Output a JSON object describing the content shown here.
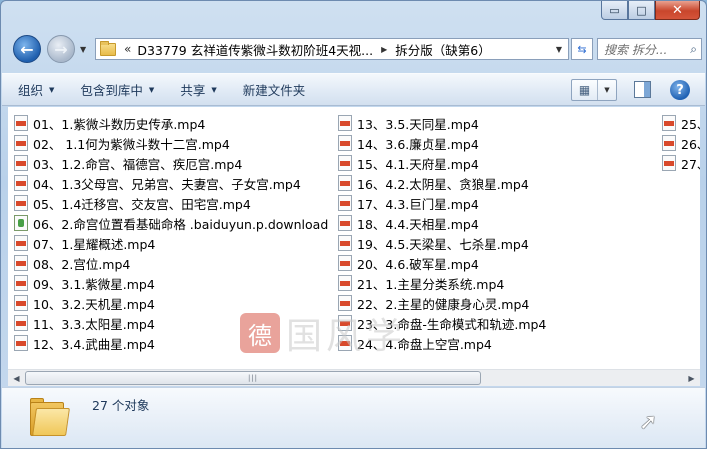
{
  "window": {
    "caption_buttons": {
      "minimize": "▭",
      "maximize": "□",
      "close": "✕"
    }
  },
  "nav": {
    "back_glyph": "←",
    "forward_glyph": "→",
    "dropdown_glyph": "▼",
    "address": {
      "chevrons": "«",
      "segments": [
        "D33779 玄祥道传紫微斗数初阶班4天视...",
        "拆分版（缺第6）"
      ],
      "separator": "▶",
      "dropdown_glyph": "▼"
    },
    "refresh_glyph": "⇆",
    "search": {
      "placeholder": "搜索 拆分...",
      "icon": "search-icon",
      "glyph": "⌕"
    }
  },
  "toolbar": {
    "organize": "组织",
    "include_in_library": "包含到库中",
    "share": "共享",
    "new_folder": "新建文件夹",
    "arrow": "▼",
    "view_icon_glyph": "▦",
    "help_glyph": "?"
  },
  "files": {
    "column1": [
      "01、1.紫微斗数历史传承.mp4",
      "02、 1.1何为紫微斗数十二宫.mp4",
      "03、1.2.命宫、福德宫、疾厄宫.mp4",
      "04、1.3父母宫、兄弟宫、夫妻宫、子女宫.mp4",
      "05、1.4迁移宫、交友宫、田宅宫.mp4",
      "06、2.命宫位置看基础命格 .baiduyun.p.download",
      "07、1.星耀概述.mp4",
      "08、2.宫位.mp4",
      "09、3.1.紫微星.mp4",
      "10、3.2.天机星.mp4",
      "11、3.3.太阳星.mp4",
      "12、3.4.武曲星.mp4"
    ],
    "column2": [
      "13、3.5.天同星.mp4",
      "14、3.6.廉贞星.mp4",
      "15、4.1.天府星.mp4",
      "16、4.2.太阴星、贪狼星.mp4",
      "17、4.3.巨门星.mp4",
      "18、4.4.天相星.mp4",
      "19、4.5.天梁星、七杀星.mp4",
      "20、4.6.破军星.mp4",
      "21、1.主星分类系统.mp4",
      "22、2.主星的健康身心灵.mp4",
      "23、3.命盘-生命模式和轨迹.mp4",
      "24、4.命盘上空宫.mp4"
    ],
    "column3": [
      "25、",
      "26、",
      "27、"
    ],
    "download_file_index": 5
  },
  "scrollbar": {
    "left_glyph": "◀",
    "right_glyph": "▶",
    "grip": "|||"
  },
  "details": {
    "object_count": "27 个对象"
  },
  "watermark": {
    "seal": "德",
    "text": "国风学"
  },
  "colors": {
    "accent": "#1f5fae",
    "mp4_icon": "#d8492b",
    "download_icon": "#48a046",
    "close_button": "#c9462c"
  }
}
